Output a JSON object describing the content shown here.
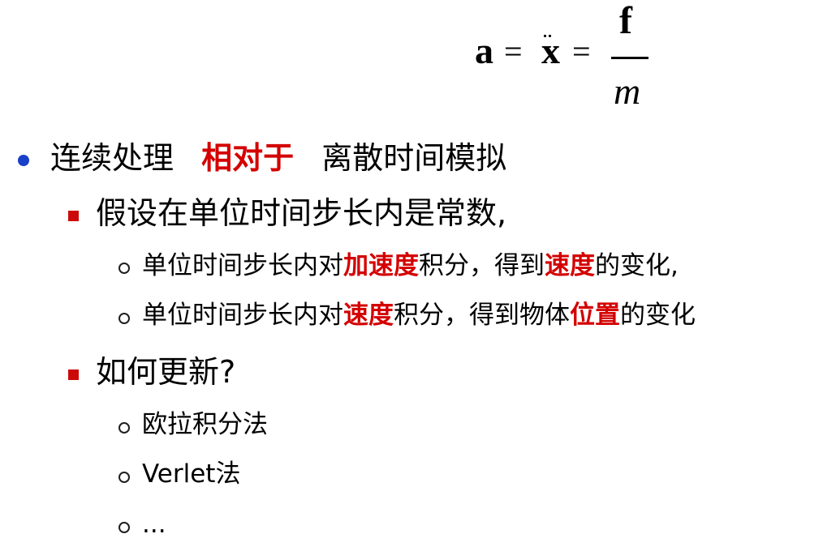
{
  "formula": {
    "a": "a",
    "eq": "=",
    "x": "x",
    "dots": "..",
    "numerator": "f",
    "denominator": "m"
  },
  "bullets": {
    "main": {
      "part1": "连续处理",
      "highlight": "相对于",
      "part2": "离散时间模拟"
    },
    "assume": {
      "text": "假设在单位时间步长内是常数,",
      "sub1": {
        "part1": "单位时间步长内对",
        "hl1": "加速度",
        "part2": "积分，得到",
        "hl2": "速度",
        "part3": "的变化,"
      },
      "sub2": {
        "part1": "单位时间步长内对",
        "hl1": "速度",
        "part2": "积分，得到物体",
        "hl2": "位置",
        "part3": "的变化"
      }
    },
    "update": {
      "text": "如何更新?",
      "items": [
        "欧拉积分法",
        "Verlet法",
        "..."
      ]
    }
  },
  "colors": {
    "highlight": "#d40000",
    "level1_bullet": "#1a3fc8",
    "level2_bullet": "#cc0a0a"
  }
}
